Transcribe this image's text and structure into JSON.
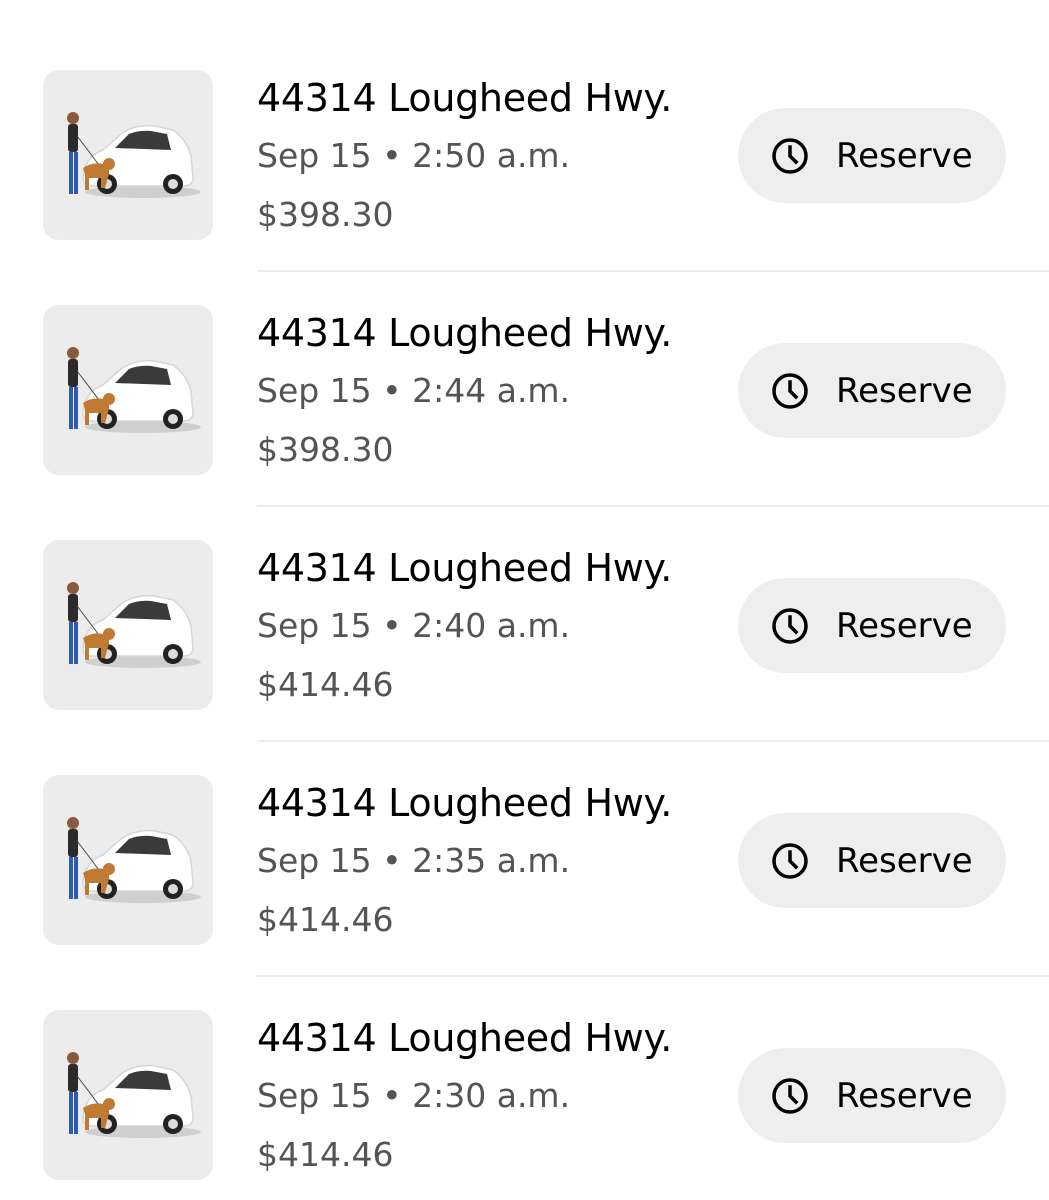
{
  "trips": [
    {
      "address": "44314 Lougheed Hwy.",
      "time": "Sep 15 • 2:50 a.m.",
      "price": "$398.30",
      "action_label": "Reserve"
    },
    {
      "address": "44314 Lougheed Hwy.",
      "time": "Sep 15 • 2:44 a.m.",
      "price": "$398.30",
      "action_label": "Reserve"
    },
    {
      "address": "44314 Lougheed Hwy.",
      "time": "Sep 15 • 2:40 a.m.",
      "price": "$414.46",
      "action_label": "Reserve"
    },
    {
      "address": "44314 Lougheed Hwy.",
      "time": "Sep 15 • 2:35 a.m.",
      "price": "$414.46",
      "action_label": "Reserve"
    },
    {
      "address": "44314 Lougheed Hwy.",
      "time": "Sep 15 • 2:30 a.m.",
      "price": "$414.46",
      "action_label": "Reserve"
    }
  ],
  "icons": {
    "thumbnail": "car-with-person-and-dog-illustration",
    "action": "clock-icon"
  },
  "colors": {
    "background": "#ffffff",
    "thumbnail_bg": "#ececec",
    "button_bg": "#eeeeee",
    "primary_text": "#000000",
    "secondary_text": "#545454",
    "divider": "#ebebeb"
  }
}
